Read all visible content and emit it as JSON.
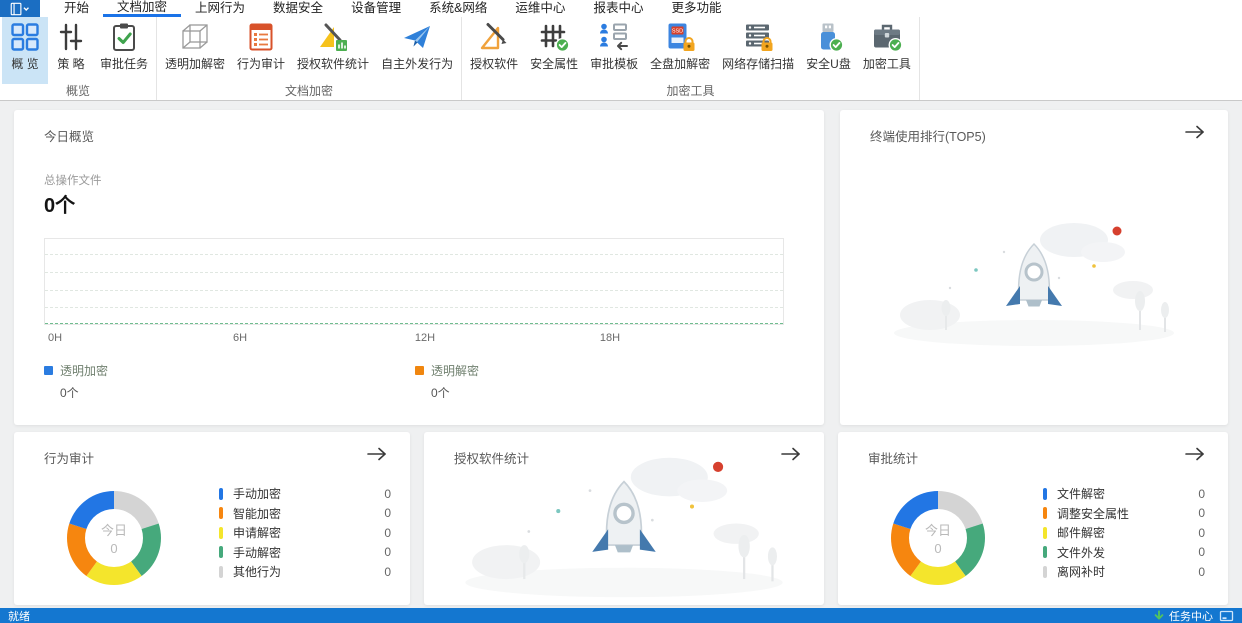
{
  "menu": {
    "tabs": [
      {
        "id": "home",
        "label": "开始",
        "active": false
      },
      {
        "id": "doc-encrypt",
        "label": "文档加密",
        "active": true
      },
      {
        "id": "web-behavior",
        "label": "上网行为",
        "active": false
      },
      {
        "id": "data-security",
        "label": "数据安全",
        "active": false
      },
      {
        "id": "device-mgmt",
        "label": "设备管理",
        "active": false
      },
      {
        "id": "system-network",
        "label": "系统&网络",
        "active": false
      },
      {
        "id": "ops-center",
        "label": "运维中心",
        "active": false
      },
      {
        "id": "report-center",
        "label": "报表中心",
        "active": false
      },
      {
        "id": "more-features",
        "label": "更多功能",
        "active": false
      }
    ]
  },
  "ribbon": {
    "groups": [
      {
        "label": "概览",
        "buttons": [
          {
            "id": "overview",
            "label": "概 览",
            "icon": "grid-icon",
            "selected": true
          },
          {
            "id": "policy",
            "label": "策 略",
            "icon": "sliders-icon",
            "selected": false
          },
          {
            "id": "approval-tasks",
            "label": "审批任务",
            "icon": "clipboard-check-icon",
            "selected": false
          }
        ]
      },
      {
        "label": "文档加密",
        "buttons": [
          {
            "id": "transparent-crypt",
            "label": "透明加解密",
            "icon": "cube-icon",
            "selected": false
          },
          {
            "id": "behavior-audit",
            "label": "行为审计",
            "icon": "doc-list-icon",
            "selected": false
          },
          {
            "id": "licensed-software-stats",
            "label": "授权软件统计",
            "icon": "chart-pencil-icon",
            "selected": false
          },
          {
            "id": "self-outgoing",
            "label": "自主外发行为",
            "icon": "paper-plane-icon",
            "selected": false
          }
        ]
      },
      {
        "label": "加密工具",
        "buttons": [
          {
            "id": "licensed-software",
            "label": "授权软件",
            "icon": "setsquare-pencil-icon",
            "selected": false
          },
          {
            "id": "security-attr",
            "label": "安全属性",
            "icon": "fence-check-icon",
            "selected": false
          },
          {
            "id": "approval-template",
            "label": "审批模板",
            "icon": "org-template-icon",
            "selected": false
          },
          {
            "id": "fulldisk-crypt",
            "label": "全盘加解密",
            "icon": "ssd-lock-icon",
            "selected": false
          },
          {
            "id": "network-storage-scan",
            "label": "网络存储扫描",
            "icon": "server-lock-icon",
            "selected": false
          },
          {
            "id": "secure-usb",
            "label": "安全U盘",
            "icon": "usb-check-icon",
            "selected": false
          },
          {
            "id": "encrypt-tools",
            "label": "加密工具",
            "icon": "toolbox-check-icon",
            "selected": false
          }
        ]
      }
    ]
  },
  "overview_card": {
    "title": "今日概览",
    "stat_label": "总操作文件",
    "stat_value": "0个",
    "ticks": [
      "0H",
      "6H",
      "12H",
      "18H"
    ],
    "legends": [
      {
        "label": "透明加密",
        "value": "0个",
        "color": "#2b7ce0"
      },
      {
        "label": "透明解密",
        "value": "0个",
        "color": "#f0860f"
      }
    ]
  },
  "terminal_card": {
    "title": "终端使用排行(TOP5)"
  },
  "behavior_card": {
    "title": "行为审计",
    "center_label": "今日",
    "center_value": "0",
    "items": [
      {
        "label": "手动加密",
        "value": "0",
        "color": "#2276e4"
      },
      {
        "label": "智能加密",
        "value": "0",
        "color": "#f6860f"
      },
      {
        "label": "申请解密",
        "value": "0",
        "color": "#f4e52c"
      },
      {
        "label": "手动解密",
        "value": "0",
        "color": "#46a97c"
      },
      {
        "label": "其他行为",
        "value": "0",
        "color": "#d4d4d4"
      }
    ]
  },
  "software_card": {
    "title": "授权软件统计"
  },
  "approval_card": {
    "title": "审批统计",
    "center_label": "今日",
    "center_value": "0",
    "items": [
      {
        "label": "文件解密",
        "value": "0",
        "color": "#2276e4"
      },
      {
        "label": "调整安全属性",
        "value": "0",
        "color": "#f6860f"
      },
      {
        "label": "邮件解密",
        "value": "0",
        "color": "#f4e52c"
      },
      {
        "label": "文件外发",
        "value": "0",
        "color": "#46a97c"
      },
      {
        "label": "离网补时",
        "value": "0",
        "color": "#d4d4d4"
      }
    ]
  },
  "statusbar": {
    "left": "就绪",
    "task_center": "任务中心"
  },
  "colors": {
    "accent": "#1a73e8",
    "statusbar_bg": "#1477d0",
    "ribbon_selected_bg": "#cbe4f6",
    "axis_green": "#6fbd8f"
  },
  "chart_data": [
    {
      "type": "line",
      "title": "今日概览 按小时文件操作量",
      "x_ticks": [
        "0H",
        "6H",
        "12H",
        "18H"
      ],
      "x_range_hours": [
        0,
        23
      ],
      "series": [
        {
          "name": "透明加密",
          "total": 0,
          "values": []
        },
        {
          "name": "透明解密",
          "total": 0,
          "values": []
        }
      ],
      "ylim": [
        0,
        0
      ],
      "grid": "dashed horizontal lines, empty (no data today)",
      "legend_position": "bottom"
    },
    {
      "type": "pie",
      "title": "行为审计(今日)",
      "center_label": "今日 0",
      "categories": [
        "手动加密",
        "智能加密",
        "申请解密",
        "手动解密",
        "其他行为"
      ],
      "values": [
        0,
        0,
        0,
        0,
        0
      ],
      "colors": [
        "#2276e4",
        "#f6860f",
        "#f4e52c",
        "#46a97c",
        "#d4d4d4"
      ],
      "donut": true,
      "legend_position": "right"
    },
    {
      "type": "pie",
      "title": "审批统计(今日)",
      "center_label": "今日 0",
      "categories": [
        "文件解密",
        "调整安全属性",
        "邮件解密",
        "文件外发",
        "离网补时"
      ],
      "values": [
        0,
        0,
        0,
        0,
        0
      ],
      "colors": [
        "#2276e4",
        "#f6860f",
        "#f4e52c",
        "#46a97c",
        "#d4d4d4"
      ],
      "donut": true,
      "legend_position": "right"
    }
  ]
}
